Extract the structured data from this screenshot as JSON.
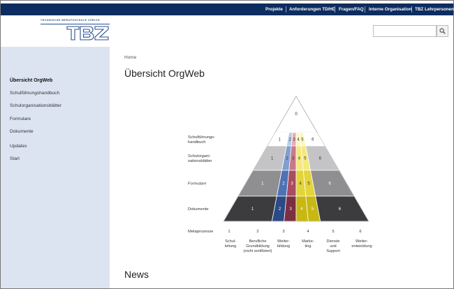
{
  "topnav": {
    "links": [
      "Projekte",
      "Anforderungen TD/HD",
      "Fragen/FAQ",
      "Interne Organisation",
      "TBZ Lehrpersonen"
    ]
  },
  "logo": {
    "tagline": "TECHNISCHE BERUFSSCHULE ZÜRICH",
    "mark": "TBZ"
  },
  "search": {
    "placeholder": "",
    "icon": "magnifier-icon"
  },
  "sidebar": {
    "items": [
      {
        "label": "Übersicht OrgWeb",
        "active": true
      },
      {
        "label": "Schulführungshandbuch"
      },
      {
        "label": "Schulorganisationsblätter"
      },
      {
        "label": "Formulare"
      },
      {
        "label": "Dokumente"
      },
      {
        "label": "Updates"
      },
      {
        "label": "Start"
      }
    ]
  },
  "breadcrumb": "Home",
  "page_title": "Übersicht OrgWeb",
  "diagram": {
    "apex": "0",
    "rows": [
      {
        "label_lines": [
          "Schulführungs-",
          "handbuch"
        ],
        "cells": [
          "1",
          "2",
          "3",
          "4",
          "5",
          "6"
        ]
      },
      {
        "label_lines": [
          "Schulorgani-",
          "sationsblätter"
        ],
        "cells": [
          "1",
          "2",
          "3",
          "4",
          "5",
          "6"
        ]
      },
      {
        "label_lines": [
          "Formulare"
        ],
        "cells": [
          "1",
          "2",
          "3",
          "4",
          "5",
          "6"
        ]
      },
      {
        "label_lines": [
          "Dokumente"
        ],
        "cells": [
          "1",
          "2",
          "3",
          "4",
          "5",
          "6"
        ]
      }
    ],
    "meta": {
      "label": "Metaprozesse",
      "numbers": [
        "1",
        "2",
        "3",
        "4",
        "5",
        "6"
      ],
      "names": [
        [
          "Schul-",
          "leitung"
        ],
        [
          "Berufliche",
          "Grundbildung",
          "(nicht zertifiziert)"
        ],
        [
          "Weiter-",
          "bildung"
        ],
        [
          "Marke-",
          "ting"
        ],
        [
          "Dienste",
          "und",
          "Support"
        ],
        [
          "Weiter-",
          "entwicklung"
        ]
      ]
    },
    "colors": {
      "col1": [
        "#ffffff",
        "#c4c4c6",
        "#8f8f91",
        "#3c3c3e"
      ],
      "col2": [
        "#b8cce8",
        "#7f9fd0",
        "#4e72b4",
        "#2a4b86"
      ],
      "col3": [
        "#e8aab9",
        "#c9798b",
        "#a84c62",
        "#7c2f43"
      ],
      "col4": [
        "#fbf6bd",
        "#f3ea7a",
        "#e3d43a",
        "#c7b812"
      ],
      "col5": [
        "#fbf6bd",
        "#f3ea7a",
        "#e3d43a",
        "#c7b812"
      ],
      "col6": [
        "#ffffff",
        "#c4c4c6",
        "#8f8f91",
        "#3c3c3e"
      ]
    }
  },
  "news_title": "News"
}
